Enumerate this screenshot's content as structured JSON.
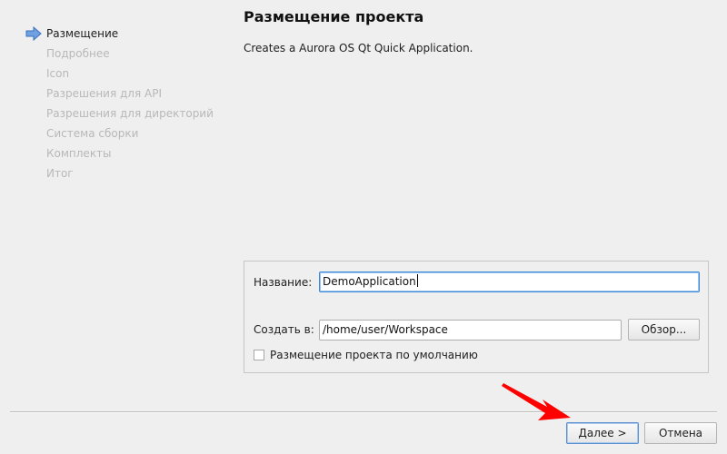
{
  "steps": [
    {
      "label": "Размещение",
      "active": true
    },
    {
      "label": "Подробнее",
      "active": false
    },
    {
      "label": "Icon",
      "active": false
    },
    {
      "label": "Разрешения для API",
      "active": false
    },
    {
      "label": "Разрешения для директорий",
      "active": false
    },
    {
      "label": "Система сборки",
      "active": false
    },
    {
      "label": "Комплекты",
      "active": false
    },
    {
      "label": "Итог",
      "active": false
    }
  ],
  "page": {
    "title": "Размещение проекта",
    "description": "Creates a Aurora OS Qt Quick Application."
  },
  "form": {
    "name_label": "Название:",
    "name_value": "DemoApplication",
    "create_label": "Создать в:",
    "path_value": "/home/user/Workspace",
    "browse_label": "Обзор...",
    "default_location_label": "Размещение проекта по умолчанию",
    "default_location_checked": false
  },
  "footer": {
    "next_label": "Далее >",
    "cancel_label": "Отмена"
  },
  "colors": {
    "active_step_arrow": "#4a86d8",
    "pointer_arrow": "#ff0000",
    "focus_border": "#3b88d8"
  }
}
